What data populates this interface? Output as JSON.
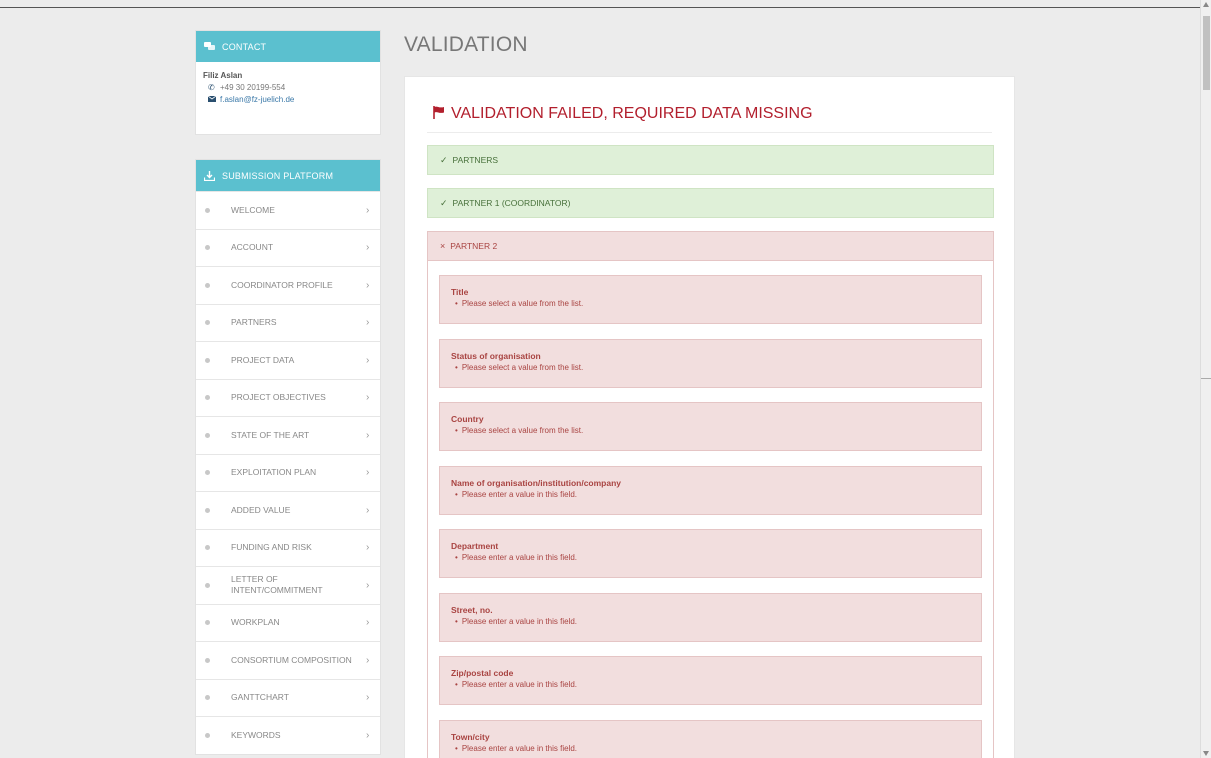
{
  "page": {
    "title": "VALIDATION"
  },
  "contact": {
    "header": "CONTACT",
    "name": "Filiz Aslan",
    "phone": "+49 30 20199-554",
    "email": "f.aslan@fz-juelich.de"
  },
  "submission": {
    "header": "SUBMISSION PLATFORM",
    "items": [
      {
        "label": "WELCOME"
      },
      {
        "label": "ACCOUNT"
      },
      {
        "label": "COORDINATOR PROFILE"
      },
      {
        "label": "PARTNERS"
      },
      {
        "label": "PROJECT DATA"
      },
      {
        "label": "PROJECT OBJECTIVES"
      },
      {
        "label": "STATE OF THE ART"
      },
      {
        "label": "EXPLOITATION PLAN"
      },
      {
        "label": "ADDED VALUE"
      },
      {
        "label": "FUNDING AND RISK"
      },
      {
        "label": "LETTER OF INTENT/COMMITMENT"
      },
      {
        "label": "WORKPLAN"
      },
      {
        "label": "CONSORTIUM COMPOSITION"
      },
      {
        "label": "GANTTCHART"
      },
      {
        "label": "KEYWORDS"
      }
    ]
  },
  "validation": {
    "status_title": "VALIDATION FAILED, REQUIRED DATA MISSING",
    "sections": [
      {
        "label": "PARTNERS",
        "status": "ok",
        "symbol": "✓"
      },
      {
        "label": "PARTNER 1 (COORDINATOR)",
        "status": "ok",
        "symbol": "✓"
      },
      {
        "label": "PARTNER 2",
        "status": "error",
        "symbol": "×"
      }
    ],
    "errors": [
      {
        "field": "Title",
        "message": "Please select a value from the list."
      },
      {
        "field": "Status of organisation",
        "message": "Please select a value from the list."
      },
      {
        "field": "Country",
        "message": "Please select a value from the list."
      },
      {
        "field": "Name of organisation/institution/company",
        "message": "Please enter a value in this field."
      },
      {
        "field": "Department",
        "message": "Please enter a value in this field."
      },
      {
        "field": "Street, no.",
        "message": "Please enter a value in this field."
      },
      {
        "field": "Zip/postal code",
        "message": "Please enter a value in this field."
      },
      {
        "field": "Town/city",
        "message": "Please enter a value in this field."
      }
    ]
  },
  "colors": {
    "accent": "#5bc0cf",
    "error_text": "#a94442",
    "error_bg": "#f2dede",
    "success_bg": "#dff0d8",
    "success_text": "#47703a"
  }
}
